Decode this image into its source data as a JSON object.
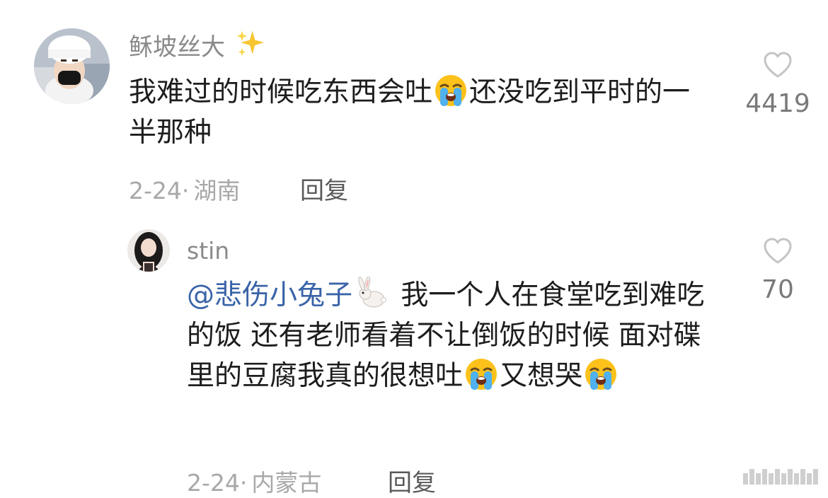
{
  "comments": [
    {
      "username": "稣坡丝大",
      "username_emoji": "sparkles",
      "text_parts": [
        "我难过的时候吃东西会吐",
        "还没吃到平时的一半那种"
      ],
      "date": "2-24",
      "separator": "·",
      "location": "湖南",
      "reply_label": "回复",
      "likes": "4419"
    },
    {
      "username": "stin",
      "mention": "@悲伤小兔子",
      "text_parts": [
        " 我一个人在食堂吃到难吃的饭 还有老师看着不让倒饭的时候 面对碟里的豆腐我真的很想吐",
        "又想哭"
      ],
      "date": "2-24",
      "separator": "·",
      "location": "内蒙古",
      "reply_label": "回复",
      "likes": "70"
    }
  ],
  "icons": {
    "like": "heart-outline-icon",
    "crying": "loudly-crying-face-emoji",
    "rabbit": "rabbit-emoji",
    "sparkles": "sparkles-emoji"
  },
  "colors": {
    "text": "#1d1d1d",
    "meta": "#a8a8a8",
    "mention": "#3a64a8",
    "like_icon": "#c4c4c4"
  }
}
